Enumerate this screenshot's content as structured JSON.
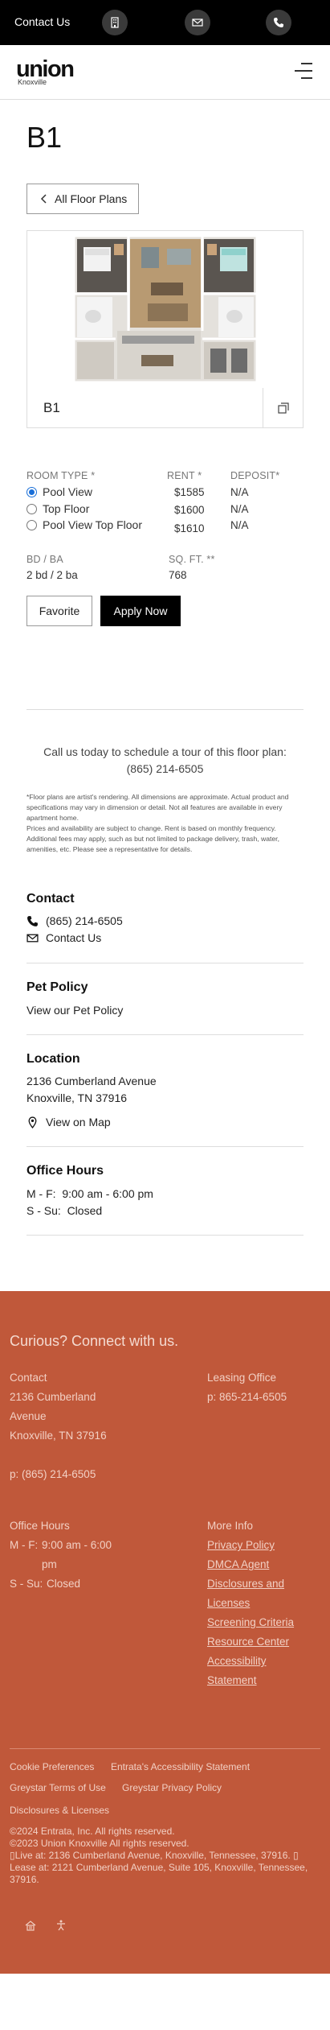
{
  "topbar": {
    "contact_link": "Contact Us",
    "icons": [
      "building-icon",
      "mail-icon",
      "phone-icon"
    ]
  },
  "header": {
    "logo_word": "union",
    "logo_sub": "Knoxville"
  },
  "page_title": "B1",
  "back_button": "All Floor Plans",
  "plan": {
    "name": "B1"
  },
  "details": {
    "room_type_label": "ROOM TYPE *",
    "rent_label": "RENT *",
    "deposit_label": "DEPOSIT*",
    "rows": [
      {
        "room": "Pool View",
        "rent": "$1585",
        "deposit": "N/A",
        "selected": true
      },
      {
        "room": "Top Floor",
        "rent": "$1600",
        "deposit": "N/A",
        "selected": false
      },
      {
        "room": "Pool View Top Floor",
        "rent": "$1610",
        "deposit": "N/A",
        "selected": false
      }
    ],
    "bdba_label": "BD / BA",
    "bdba_value": "2 bd / 2 ba",
    "sqft_label": "SQ. FT. **",
    "sqft_value": "768"
  },
  "actions": {
    "favorite": "Favorite",
    "apply": "Apply Now"
  },
  "call": {
    "line1": "Call us today to schedule a tour of this floor plan:",
    "line2": "(865) 214-6505"
  },
  "fine_print": {
    "p1": "*Floor plans are artist's rendering. All dimensions are approximate. Actual product and specifications may vary in dimension or detail. Not all features are available in every apartment home.",
    "p2": "Prices and availability are subject to change. Rent is based on monthly frequency. Additional fees may apply, such as but not limited to package delivery, trash, water, amenities, etc. Please see a representative for details."
  },
  "contact": {
    "title": "Contact",
    "phone": "(865) 214-6505",
    "contact_us": "Contact Us"
  },
  "pet": {
    "title": "Pet Policy",
    "link": "View our Pet Policy"
  },
  "location": {
    "title": "Location",
    "line1": "2136 Cumberland Avenue",
    "line2": "Knoxville, TN 37916",
    "map": "View on Map"
  },
  "hours": {
    "title": "Office Hours",
    "line1": "M - F:  9:00 am - 6:00 pm",
    "line2": "S - Su:  Closed"
  },
  "footer": {
    "heading": "Curious? Connect with us.",
    "contact_title": "Contact",
    "addr1": "2136 Cumberland",
    "addr2": "Avenue",
    "addr3": "Knoxville, TN 37916",
    "phone": "p: (865) 214-6505",
    "leasing_title": "Leasing Office",
    "leasing_phone": "p: 865-214-6505",
    "hours_title": "Office Hours",
    "hours_mf": "M - F:",
    "hours_mf_val1": "9:00 am - 6:00",
    "hours_mf_val2": "pm",
    "hours_ss": "S - Su:",
    "hours_ss_val": "Closed",
    "more_title": "More Info",
    "more_links": [
      "Privacy Policy",
      "DMCA Agent",
      "Disclosures and",
      "Licenses",
      "Screening Criteria",
      "Resource Center",
      "Accessibility",
      "Statement"
    ],
    "bottom_links": [
      "Cookie Preferences",
      "Entrata's Accessibility Statement",
      "Greystar Terms of Use",
      "Greystar Privacy Policy",
      "Disclosures & Licenses"
    ],
    "copy1": "©2024 Entrata, Inc. All rights reserved.",
    "copy2": "©2023 Union Knoxville All rights reserved.",
    "copy3": "Live at: 2136 Cumberland Avenue, Knoxville, Tennessee, 37916. ",
    "copy4": "Lease at: 2121 Cumberland Avenue, Suite 105, Knoxville, Tennessee,",
    "copy5": "37916."
  }
}
